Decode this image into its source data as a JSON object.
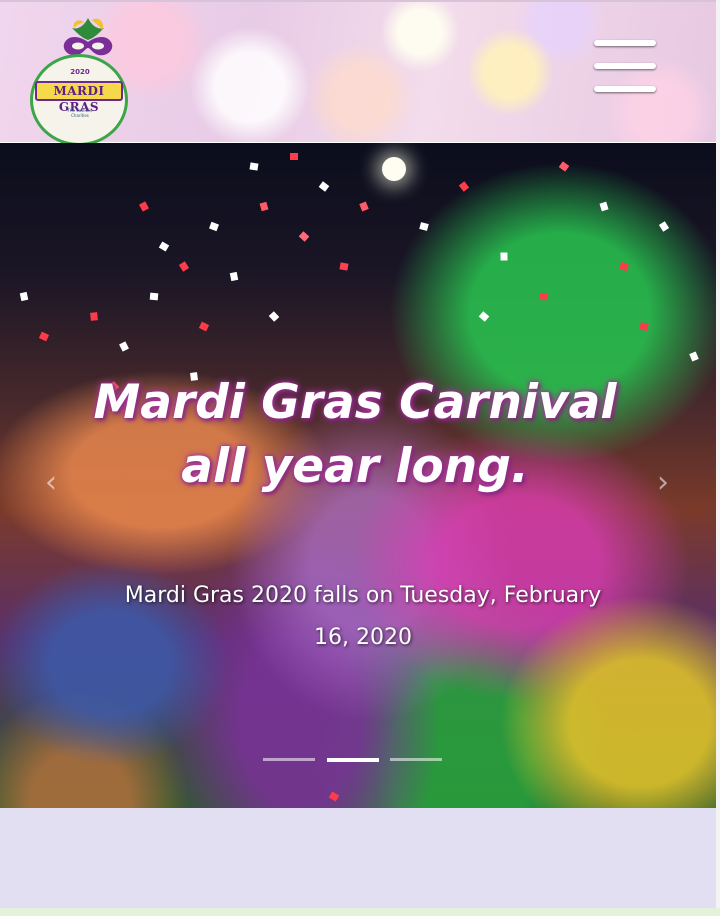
{
  "logo": {
    "year": "2020",
    "word": "MARDI GRAS",
    "sub": "The Catholic Charities"
  },
  "menu": {
    "icon": "hamburger-menu-icon"
  },
  "hero": {
    "title": "Mardi Gras Carnival all year long.",
    "subtitle": "Mardi Gras 2020 falls on Tuesday, February 16, 2020",
    "slides": 3,
    "active_slide": 2
  },
  "colors": {
    "title_glow": "#b03aa0",
    "logo_purple": "#6b2b8e",
    "logo_green": "#3aa648",
    "logo_gold": "#f5d94a",
    "section_bg": "#e3dff3"
  }
}
